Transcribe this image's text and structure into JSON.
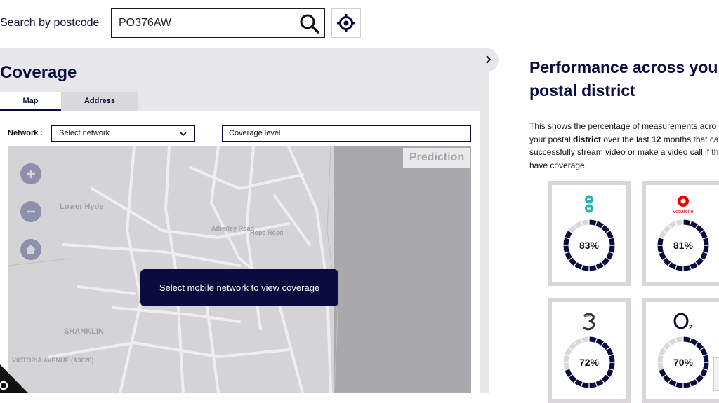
{
  "search": {
    "label": "Search by postcode",
    "value": "PO376AW"
  },
  "coverage": {
    "title": "Coverage",
    "tabs": [
      {
        "label": "Map",
        "active": true
      },
      {
        "label": "Address",
        "active": false
      }
    ],
    "network_label": "Network :",
    "network_select": "Select network",
    "coverage_level": "Coverage level",
    "map": {
      "prediction_badge": "Prediction",
      "toast": "Select mobile network to view coverage",
      "place_labels": [
        "Lower Hyde",
        "SHANKLIN",
        "VICTORIA AVENUE (A3020)",
        "Atherley Road",
        "Hope Road"
      ]
    }
  },
  "performance": {
    "title_lines": [
      "Performance across you",
      "postal district"
    ],
    "description_lines": [
      "This shows the percentage of measurements acro",
      "your postal district over the last 12 months that ca",
      "successfully stream video or make a video call if th",
      "have coverage."
    ],
    "operators": [
      {
        "name": "EE",
        "percent": 83,
        "label": "83%",
        "logo_color": "#2bb3b1"
      },
      {
        "name": "vodafone",
        "percent": 81,
        "label": "81%",
        "logo_color": "#e60000"
      },
      {
        "name": "Three",
        "percent": 72,
        "label": "72%",
        "logo_color": "#333333"
      },
      {
        "name": "O2",
        "percent": 70,
        "label": "70%",
        "logo_color": "#0b0c3e"
      }
    ]
  },
  "colors": {
    "brand_navy": "#0b0c3e",
    "panel_grey": "#e7e7ea",
    "ring_track": "#d9d9dc"
  }
}
